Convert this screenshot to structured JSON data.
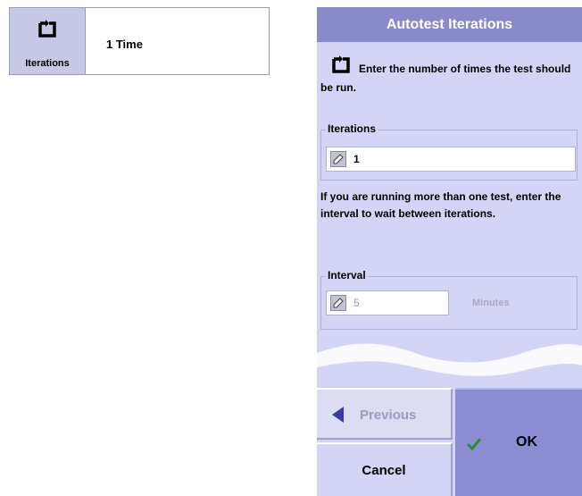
{
  "summary": {
    "button_label": "Iterations",
    "value": "1 Time"
  },
  "dialog": {
    "title": "Autotest Iterations",
    "intro_text": "Enter the number of times the test should be run.",
    "iterations": {
      "label": "Iterations",
      "value": "1"
    },
    "help_text": "If you are running more than one test, enter the interval to wait between iterations.",
    "interval": {
      "label": "Interval",
      "value": "5",
      "units": "Minutes",
      "disabled": true
    },
    "buttons": {
      "previous": "Previous",
      "cancel": "Cancel",
      "ok": "OK"
    }
  },
  "icons": {
    "iterations": "loop-arrow-icon",
    "field_edit": "edit-icon",
    "previous": "left-arrow-icon",
    "ok": "checkmark-icon"
  },
  "colors": {
    "dialog_bg": "#d4d4f6",
    "titlebar_bg": "#8a8aca",
    "ok_bg": "#8c8cd2",
    "checkmark": "#2e8a2e",
    "arrow": "#3a3aa0"
  }
}
